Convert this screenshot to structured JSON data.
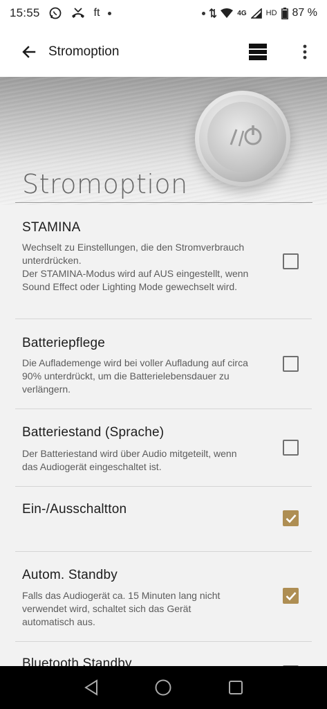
{
  "status_bar": {
    "time": "15:55",
    "app_icons": [
      "whatsapp-icon",
      "missed-call-icon",
      "ft-icon"
    ],
    "ft_label": "ft",
    "network_label": "4G",
    "hd_label": "HD",
    "battery_text": "87 %"
  },
  "app_bar": {
    "title": "Stromoption"
  },
  "banner": {
    "title": "Stromoption"
  },
  "settings": [
    {
      "title": "STAMINA",
      "description": "Wechselt zu Einstellungen, die den Stromverbrauch unterdrücken.\nDer STAMINA-Modus wird auf AUS eingestellt, wenn Sound Effect oder Lighting Mode gewechselt wird.",
      "checked": false
    },
    {
      "title": "Batteriepflege",
      "description": "Die Auflademenge wird bei voller Aufladung auf circa 90% unterdrückt, um die Batterielebensdauer zu verlängern.",
      "checked": false
    },
    {
      "title": "Batteriestand (Sprache)",
      "description": "Der Batteriestand wird über Audio mitgeteilt, wenn das Audiogerät eingeschaltet ist.",
      "checked": false
    },
    {
      "title": "Ein-/Ausschaltton",
      "description": "",
      "checked": true
    },
    {
      "title": "Autom. Standby",
      "description": "Falls das Audiogerät ca. 15 Minuten lang nicht verwendet wird, schaltet sich das Gerät automatisch aus.",
      "checked": true
    },
    {
      "title": "Bluetooth Standby",
      "description": "",
      "checked": false
    }
  ],
  "colors": {
    "accent": "#ae8e53",
    "checkbox_border": "#6f6f6f",
    "nav_bar": "#000000"
  }
}
